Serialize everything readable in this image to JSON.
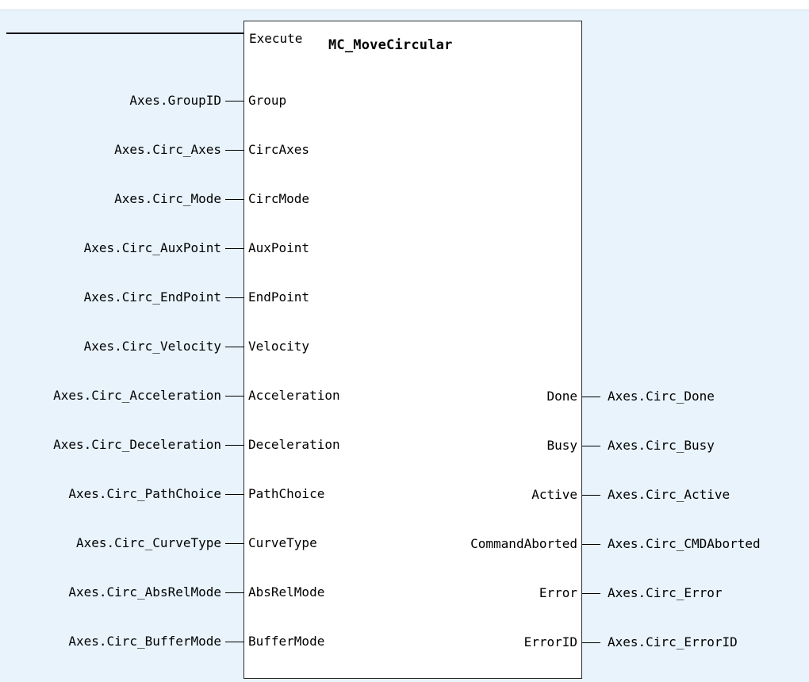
{
  "block": {
    "title": "MC_MoveCircular",
    "execute_pin": "Execute"
  },
  "inputs": [
    {
      "pin": "Group",
      "var": "Axes.GroupID"
    },
    {
      "pin": "CircAxes",
      "var": "Axes.Circ_Axes"
    },
    {
      "pin": "CircMode",
      "var": "Axes.Circ_Mode"
    },
    {
      "pin": "AuxPoint",
      "var": "Axes.Circ_AuxPoint"
    },
    {
      "pin": "EndPoint",
      "var": "Axes.Circ_EndPoint"
    },
    {
      "pin": "Velocity",
      "var": "Axes.Circ_Velocity"
    },
    {
      "pin": "Acceleration",
      "var": "Axes.Circ_Acceleration"
    },
    {
      "pin": "Deceleration",
      "var": "Axes.Circ_Deceleration"
    },
    {
      "pin": "PathChoice",
      "var": "Axes.Circ_PathChoice"
    },
    {
      "pin": "CurveType",
      "var": "Axes.Circ_CurveType"
    },
    {
      "pin": "AbsRelMode",
      "var": "Axes.Circ_AbsRelMode"
    },
    {
      "pin": "BufferMode",
      "var": "Axes.Circ_BufferMode"
    }
  ],
  "outputs": [
    {
      "pin": "Done",
      "var": "Axes.Circ_Done"
    },
    {
      "pin": "Busy",
      "var": "Axes.Circ_Busy"
    },
    {
      "pin": "Active",
      "var": "Axes.Circ_Active"
    },
    {
      "pin": "CommandAborted",
      "var": "Axes.Circ_CMDAborted"
    },
    {
      "pin": "Error",
      "var": "Axes.Circ_Error"
    },
    {
      "pin": "ErrorID",
      "var": "Axes.Circ_ErrorID"
    }
  ],
  "colors": {
    "background": "#e8f3fc",
    "block_fill": "#ffffff",
    "line": "#000000"
  }
}
